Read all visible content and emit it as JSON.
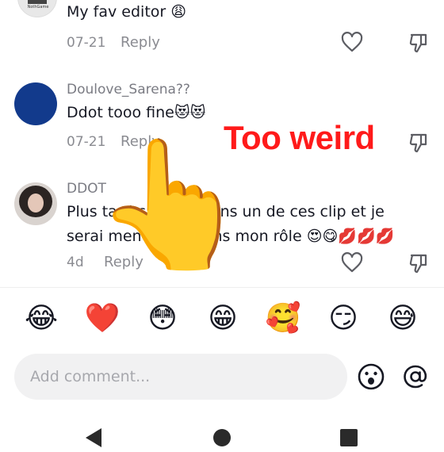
{
  "comments": [
    {
      "avatar_text": "NothGame",
      "text": "My fav editor 😩",
      "date": "07-21",
      "reply_label": "Reply"
    },
    {
      "username": "Doulove_Sarena??",
      "text": "Ddot tooo fine😻😻",
      "date": "07-21",
      "reply_label": "Reply"
    },
    {
      "username": "DDOT",
      "text_line1": "Plus tard ça serai dans un de ces clip et je",
      "text_line2": "serai mentionné dans mon rôle 😍😋💋💋💋",
      "date": "4d",
      "reply_label": "Reply"
    }
  ],
  "overlay": {
    "caption": "Too weird",
    "pointer_emoji": "👆"
  },
  "emoji_bar": [
    "😂",
    "❤️",
    "😳",
    "😁",
    "🥰",
    "😏",
    "😅"
  ],
  "input": {
    "placeholder": "Add comment..."
  },
  "colors": {
    "overlay_caption": "#ff1a1a",
    "muted_text": "#8a8b91",
    "input_background": "#f1f1f2",
    "avatar_blue": "#123a8c"
  },
  "icons": [
    "heart-outline-icon",
    "dislike-icon",
    "emoji-icon",
    "at-icon",
    "back-icon",
    "home-icon",
    "recents-icon"
  ]
}
